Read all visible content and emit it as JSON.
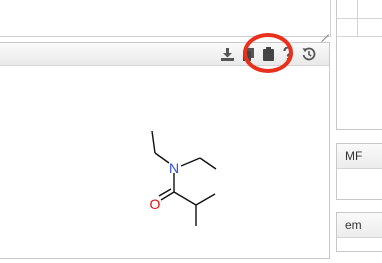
{
  "toolbar": {
    "icons": [
      "download-icon",
      "copy-icon",
      "clipboard-icon",
      "help-icon",
      "history-icon"
    ],
    "accent": "#e8301c"
  },
  "molecule": {
    "atoms": [
      {
        "label": "N",
        "color": "#2f4fd8"
      },
      {
        "label": "O",
        "color": "#e01010"
      }
    ]
  },
  "right_panel": {
    "mf_label": "MF",
    "em_label": "em"
  }
}
